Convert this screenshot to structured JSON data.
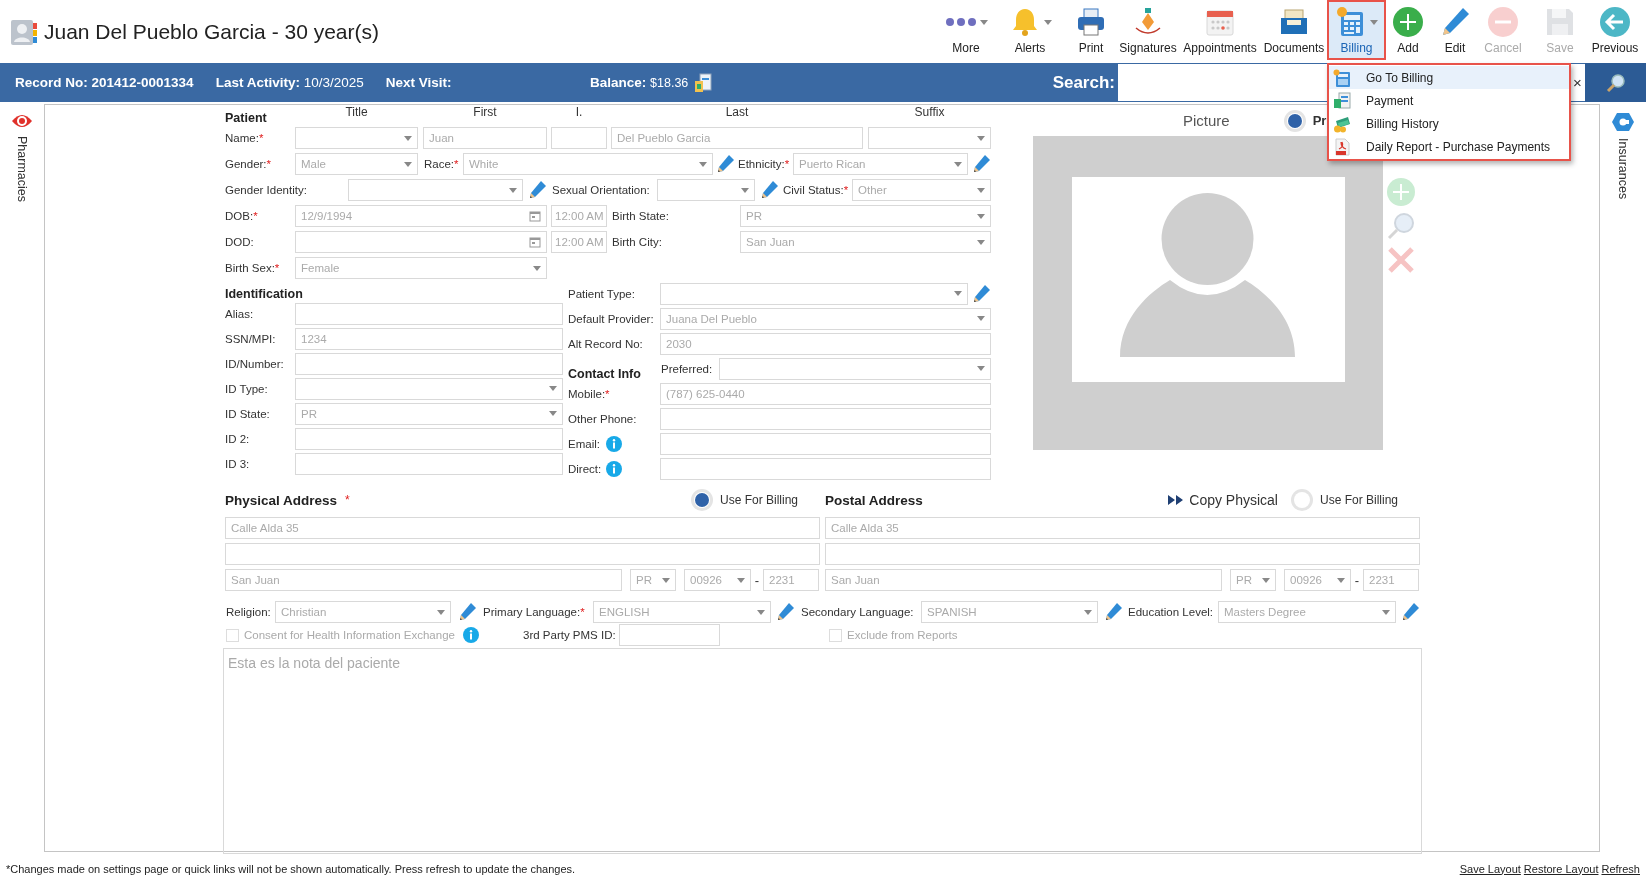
{
  "header": {
    "title": "Juan Del Pueblo Garcia - 30 year(s)"
  },
  "toolbar": [
    {
      "kind": "more",
      "label": "More",
      "dropdown": true,
      "disabled": false,
      "selected": false
    },
    {
      "kind": "alerts",
      "label": "Alerts",
      "dropdown": true,
      "disabled": false,
      "selected": false
    },
    {
      "kind": "print",
      "label": "Print",
      "dropdown": false,
      "disabled": false,
      "selected": false
    },
    {
      "kind": "signatures",
      "label": "Signatures",
      "dropdown": false,
      "disabled": false,
      "selected": false
    },
    {
      "kind": "appointments",
      "label": "Appointments",
      "dropdown": false,
      "disabled": false,
      "selected": false
    },
    {
      "kind": "documents",
      "label": "Documents",
      "dropdown": false,
      "disabled": false,
      "selected": false
    },
    {
      "kind": "billing",
      "label": "Billing",
      "dropdown": true,
      "disabled": false,
      "selected": true
    },
    {
      "kind": "add",
      "label": "Add",
      "dropdown": false,
      "disabled": false,
      "selected": false
    },
    {
      "kind": "edit",
      "label": "Edit",
      "dropdown": false,
      "disabled": false,
      "selected": false
    },
    {
      "kind": "cancel",
      "label": "Cancel",
      "dropdown": false,
      "disabled": true,
      "selected": false
    },
    {
      "kind": "save",
      "label": "Save",
      "dropdown": false,
      "disabled": true,
      "selected": false
    },
    {
      "kind": "previous",
      "label": "Previous",
      "dropdown": false,
      "disabled": false,
      "selected": false
    }
  ],
  "billing_menu": [
    {
      "kind": "billing",
      "label": "Go To Billing",
      "selected": true
    },
    {
      "kind": "payment",
      "label": "Payment",
      "selected": false
    },
    {
      "kind": "history",
      "label": "Billing History",
      "selected": false
    },
    {
      "kind": "report",
      "label": "Daily Report - Purchase Payments",
      "selected": false
    }
  ],
  "info_bar": {
    "fields": [
      {
        "label": "Record No:",
        "value": "201412-0001334",
        "bold_value": true
      },
      {
        "label": "Last Activity:",
        "value": "10/3/2025",
        "bold_value": false
      },
      {
        "label": "Next Visit:"
      }
    ],
    "balance": {
      "label": "Balance:",
      "value": "$18.36"
    },
    "search": {
      "label": "Search:",
      "clear": "×"
    }
  },
  "side_tabs": {
    "left": {
      "label": "Pharmacies"
    },
    "right": {
      "label": "Insurances"
    }
  },
  "patient": {
    "rows": [
      [
        {
          "kind": "heading",
          "text": "Patient"
        },
        {
          "kind": "colhead",
          "text": "Title"
        },
        {
          "kind": "colhead",
          "text": "First"
        },
        {
          "kind": "colhead",
          "text": "I."
        },
        {
          "kind": "colhead",
          "text": "Last"
        },
        {
          "kind": "colhead",
          "text": "Suffix"
        }
      ],
      [
        {
          "kind": "label",
          "text": "Name:",
          "required_mark": "*"
        },
        {
          "kind": "select"
        },
        {
          "kind": "input",
          "value": "Juan"
        },
        {
          "kind": "input"
        },
        {
          "kind": "input",
          "value": "Del Pueblo Garcia"
        },
        {
          "kind": "select"
        }
      ],
      [
        {
          "kind": "label",
          "text": "Gender:",
          "required_mark": "*"
        },
        {
          "kind": "select",
          "value": "Male"
        },
        {
          "kind": "label",
          "text": "Race:",
          "required_mark": "*"
        },
        {
          "kind": "select",
          "value": "White"
        },
        {
          "kind": "edit"
        },
        {
          "kind": "label",
          "text": "Ethnicity:",
          "required_mark": "*"
        },
        {
          "kind": "select",
          "value": "Puerto Rican"
        },
        {
          "kind": "edit"
        }
      ],
      [
        {
          "kind": "label",
          "text": "Gender Identity:"
        },
        {
          "kind": "select"
        },
        {
          "kind": "edit"
        },
        {
          "kind": "label",
          "text": "Sexual Orientation:"
        },
        {
          "kind": "select"
        },
        {
          "kind": "edit"
        },
        {
          "kind": "label",
          "text": "Civil Status:",
          "required_mark": "*"
        },
        {
          "kind": "select",
          "value": "Other"
        }
      ],
      [
        {
          "kind": "label",
          "text": "DOB:",
          "required_mark": "*"
        },
        {
          "kind": "date",
          "value": "12/9/1994"
        },
        {
          "kind": "time",
          "value": "12:00 AM"
        },
        {
          "kind": "label",
          "text": "Birth State:"
        },
        {
          "kind": "select",
          "value": "PR"
        }
      ],
      [
        {
          "kind": "label",
          "text": "DOD:"
        },
        {
          "kind": "date"
        },
        {
          "kind": "time",
          "value": "12:00 AM"
        },
        {
          "kind": "label",
          "text": "Birth City:"
        },
        {
          "kind": "select",
          "value": "San Juan"
        }
      ],
      [
        {
          "kind": "label",
          "text": "Birth Sex:",
          "required_mark": "*"
        },
        {
          "kind": "select",
          "value": "Female"
        }
      ]
    ]
  },
  "identification": {
    "left": [
      [
        {
          "kind": "heading",
          "text": "Identification"
        }
      ],
      [
        {
          "kind": "label",
          "text": "Alias:"
        },
        {
          "kind": "input"
        }
      ],
      [
        {
          "kind": "label",
          "text": "SSN/MPI:"
        },
        {
          "kind": "input",
          "value": "1234"
        }
      ],
      [
        {
          "kind": "label",
          "text": "ID/Number:"
        },
        {
          "kind": "input"
        }
      ],
      [
        {
          "kind": "label",
          "text": "ID Type:"
        },
        {
          "kind": "select"
        }
      ],
      [
        {
          "kind": "label",
          "text": "ID State:"
        },
        {
          "kind": "select",
          "value": "PR"
        }
      ],
      [
        {
          "kind": "label",
          "text": "ID 2:"
        },
        {
          "kind": "input"
        }
      ],
      [
        {
          "kind": "label",
          "text": "ID 3:"
        },
        {
          "kind": "input"
        }
      ]
    ],
    "right": [
      [
        {
          "kind": "label",
          "text": "Patient Type:"
        },
        {
          "kind": "select"
        },
        {
          "kind": "edit"
        }
      ],
      [
        {
          "kind": "label",
          "text": "Default Provider:"
        },
        {
          "kind": "select",
          "value": "Juana Del Pueblo"
        }
      ],
      [
        {
          "kind": "label",
          "text": "Alt Record No:"
        },
        {
          "kind": "input",
          "value": "2030"
        }
      ],
      [
        {
          "kind": "heading",
          "text": "Contact Info"
        },
        {
          "kind": "label",
          "text": "Preferred:"
        },
        {
          "kind": "select"
        }
      ],
      [
        {
          "kind": "label",
          "text": "Mobile:",
          "required_mark": "*"
        },
        {
          "kind": "input",
          "value": "(787) 625-0440"
        }
      ],
      [
        {
          "kind": "label",
          "text": "Other Phone:"
        },
        {
          "kind": "input"
        }
      ],
      [
        {
          "kind": "label",
          "text": "Email:"
        },
        {
          "kind": "info"
        },
        {
          "kind": "input"
        }
      ],
      [
        {
          "kind": "label",
          "text": "Direct:"
        },
        {
          "kind": "info"
        },
        {
          "kind": "input"
        }
      ]
    ]
  },
  "picture": {
    "title": "Picture",
    "option": {
      "label": "Pr",
      "selected": true
    }
  },
  "addresses": [
    {
      "title": "Physical Address",
      "required_mark": "*",
      "billing": {
        "label": "Use For Billing",
        "selected": true
      },
      "line1": "Calle Alda 35",
      "city": "San Juan",
      "state": "PR",
      "zip": "00926",
      "zip_separator": "-",
      "zip_ext": "2231"
    },
    {
      "title": "Postal Address",
      "copy": {
        "label": "Copy Physical"
      },
      "billing": {
        "label": "Use For Billing",
        "selected": false
      },
      "line1": "Calle Alda 35",
      "city": "San Juan",
      "state": "PR",
      "zip": "00926",
      "zip_separator": "-",
      "zip_ext": "2231"
    }
  ],
  "demographics": [
    {
      "kind": "label",
      "text": "Religion:"
    },
    {
      "kind": "select",
      "value": "Christian"
    },
    {
      "kind": "edit"
    },
    {
      "kind": "label",
      "text": "Primary Language:",
      "required_mark": "*"
    },
    {
      "kind": "select",
      "value": "ENGLISH"
    },
    {
      "kind": "edit"
    },
    {
      "kind": "label",
      "text": "Secondary Language:"
    },
    {
      "kind": "select",
      "value": "SPANISH"
    },
    {
      "kind": "edit"
    },
    {
      "kind": "label",
      "text": "Education Level:"
    },
    {
      "kind": "select",
      "value": "Masters Degree"
    },
    {
      "kind": "edit"
    }
  ],
  "options": [
    {
      "kind": "checkbox",
      "label": "Consent for Health Information Exchange",
      "checked": false
    },
    {
      "kind": "info"
    },
    {
      "kind": "label",
      "text": "3rd Party PMS ID:"
    },
    {
      "kind": "input"
    },
    {
      "kind": "checkbox",
      "label": "Exclude from Reports",
      "checked": false
    }
  ],
  "notes": {
    "value": "Esta es la nota del paciente"
  },
  "footer": {
    "note": "*Changes made on settings page or quick links will not be shown automatically. Press refresh to update the changes.",
    "links": [
      "Save Layout",
      "Restore Layout",
      "Refresh"
    ]
  }
}
